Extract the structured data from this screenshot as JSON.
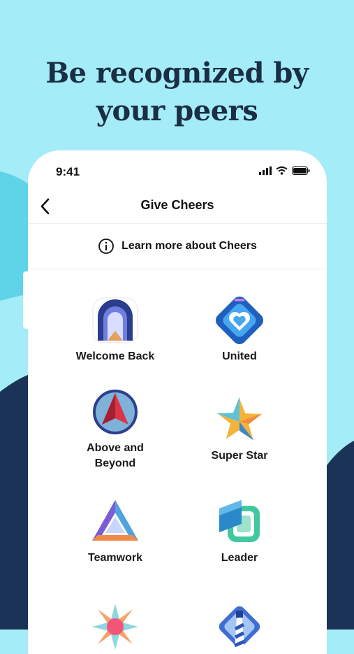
{
  "headline": {
    "line1": "Be recognized by",
    "line2": "your peers"
  },
  "status_bar": {
    "time": "9:41"
  },
  "nav": {
    "title": "Give Cheers"
  },
  "info": {
    "label": "Learn more about Cheers"
  },
  "badges": [
    {
      "label": "Welcome Back",
      "icon": "welcome-back-icon"
    },
    {
      "label": "United",
      "icon": "united-icon"
    },
    {
      "label_line1": "Above and",
      "label_line2": "Beyond",
      "icon": "above-and-beyond-icon"
    },
    {
      "label": "Super Star",
      "icon": "super-star-icon"
    },
    {
      "label": "Teamwork",
      "icon": "teamwork-icon"
    },
    {
      "label": "Leader",
      "icon": "leader-icon"
    },
    {
      "label": "",
      "icon": "burst-icon"
    },
    {
      "label": "",
      "icon": "lighthouse-icon"
    }
  ],
  "colors": {
    "background": "#a4ecf7",
    "navy": "#1b2e44",
    "phone": "#ffffff"
  }
}
